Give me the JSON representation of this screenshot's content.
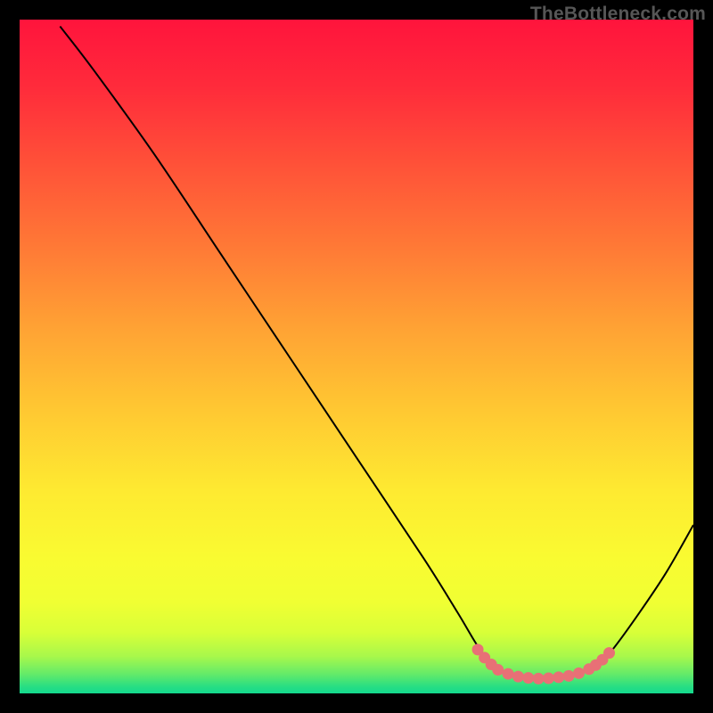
{
  "watermark": "TheBottleneck.com",
  "chart_data": {
    "type": "line",
    "title": "",
    "xlabel": "",
    "ylabel": "",
    "xlim": [
      0,
      100
    ],
    "ylim": [
      0,
      100
    ],
    "grid": false,
    "series": [
      {
        "name": "curve",
        "type": "line",
        "color": "#000000",
        "data": [
          {
            "x": 6,
            "y": 99
          },
          {
            "x": 11,
            "y": 92.5
          },
          {
            "x": 20,
            "y": 80
          },
          {
            "x": 30,
            "y": 65
          },
          {
            "x": 40,
            "y": 50
          },
          {
            "x": 50,
            "y": 35
          },
          {
            "x": 60,
            "y": 20
          },
          {
            "x": 65,
            "y": 12
          },
          {
            "x": 68,
            "y": 7
          },
          {
            "x": 70,
            "y": 4.5
          },
          {
            "x": 72,
            "y": 3
          },
          {
            "x": 75,
            "y": 2.3
          },
          {
            "x": 78,
            "y": 2.2
          },
          {
            "x": 81,
            "y": 2.5
          },
          {
            "x": 84,
            "y": 3.3
          },
          {
            "x": 86,
            "y": 4.5
          },
          {
            "x": 88,
            "y": 6.5
          },
          {
            "x": 92,
            "y": 12
          },
          {
            "x": 96,
            "y": 18
          },
          {
            "x": 100,
            "y": 25
          }
        ]
      },
      {
        "name": "optimal-region",
        "type": "scatter",
        "color": "#e87076",
        "data": [
          {
            "x": 68.0,
            "y": 6.5
          },
          {
            "x": 69.0,
            "y": 5.3
          },
          {
            "x": 70.0,
            "y": 4.3
          },
          {
            "x": 71.0,
            "y": 3.5
          },
          {
            "x": 72.5,
            "y": 2.9
          },
          {
            "x": 74.0,
            "y": 2.5
          },
          {
            "x": 75.5,
            "y": 2.3
          },
          {
            "x": 77.0,
            "y": 2.2
          },
          {
            "x": 78.5,
            "y": 2.25
          },
          {
            "x": 80.0,
            "y": 2.4
          },
          {
            "x": 81.5,
            "y": 2.6
          },
          {
            "x": 83.0,
            "y": 3.0
          },
          {
            "x": 84.5,
            "y": 3.6
          },
          {
            "x": 85.5,
            "y": 4.2
          },
          {
            "x": 86.5,
            "y": 5.0
          },
          {
            "x": 87.5,
            "y": 6.0
          }
        ]
      }
    ],
    "gradient_stops": [
      {
        "offset": 0.0,
        "color": "#ff143c"
      },
      {
        "offset": 0.1,
        "color": "#ff2b3b"
      },
      {
        "offset": 0.22,
        "color": "#ff5338"
      },
      {
        "offset": 0.34,
        "color": "#ff7a36"
      },
      {
        "offset": 0.46,
        "color": "#ffa334"
      },
      {
        "offset": 0.58,
        "color": "#ffc832"
      },
      {
        "offset": 0.7,
        "color": "#feea31"
      },
      {
        "offset": 0.8,
        "color": "#f9fb31"
      },
      {
        "offset": 0.865,
        "color": "#f0ff33"
      },
      {
        "offset": 0.91,
        "color": "#d8ff38"
      },
      {
        "offset": 0.945,
        "color": "#a8f84b"
      },
      {
        "offset": 0.972,
        "color": "#62ea6a"
      },
      {
        "offset": 0.99,
        "color": "#28de83"
      },
      {
        "offset": 1.0,
        "color": "#13d98e"
      }
    ]
  }
}
